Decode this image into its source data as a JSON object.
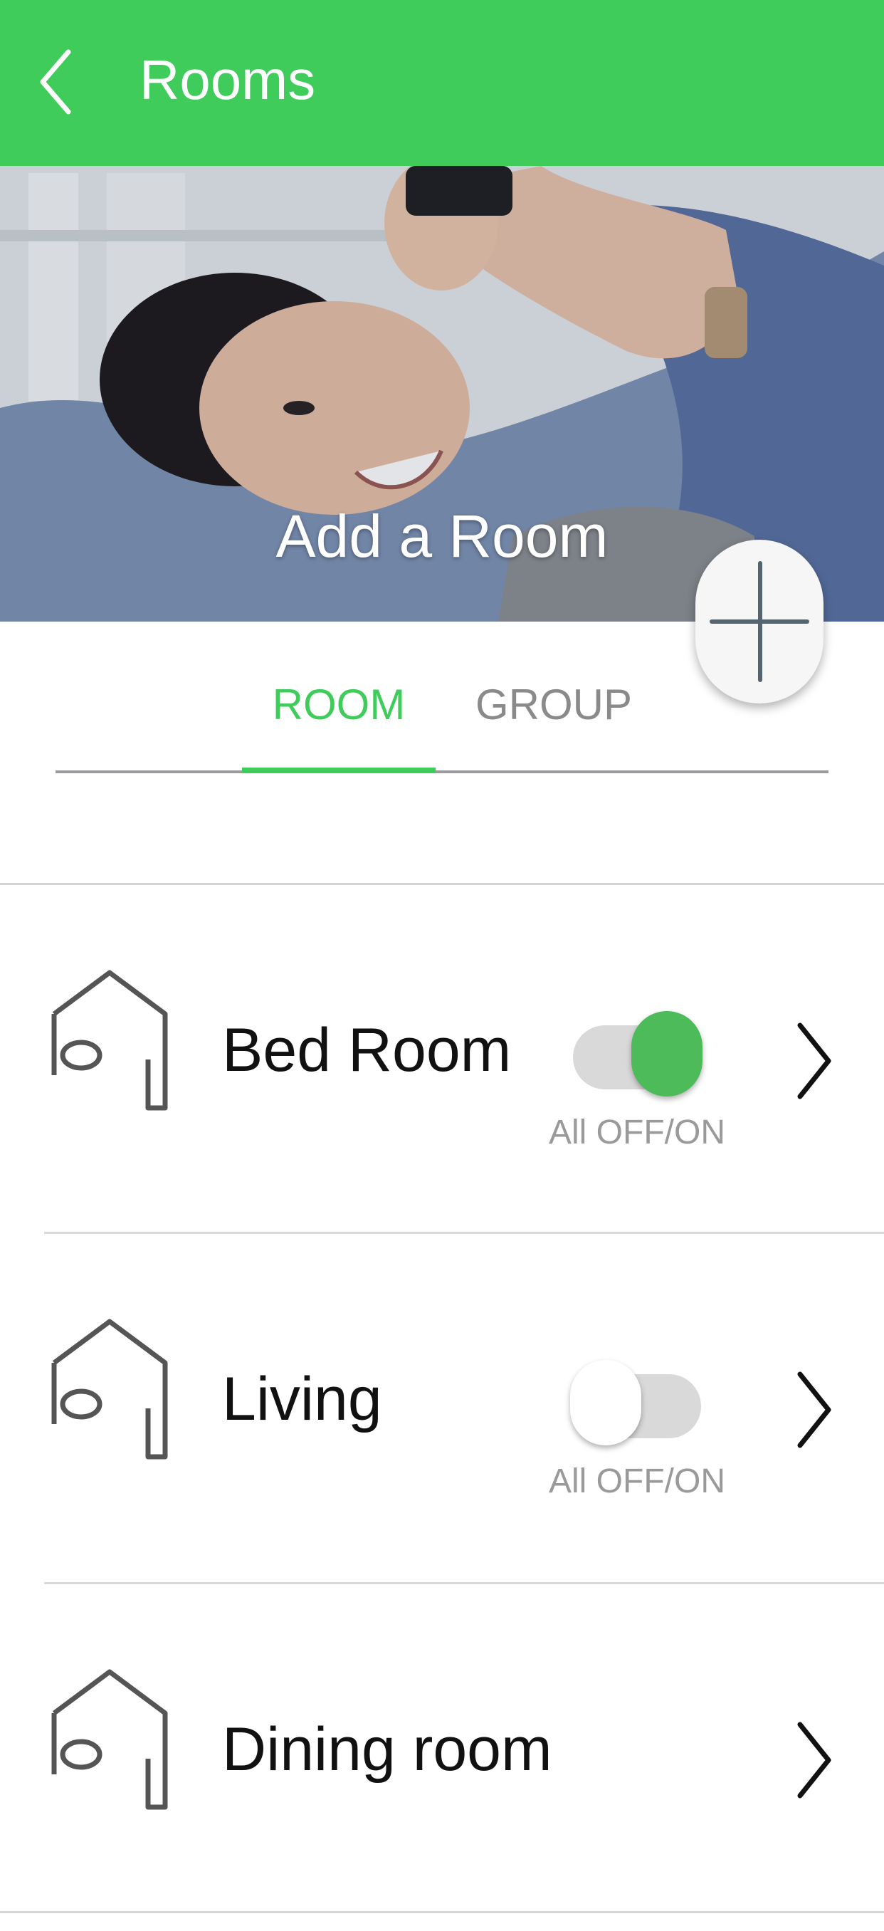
{
  "header": {
    "title": "Rooms",
    "back_icon": "chevron-left-icon",
    "background_color": "#3fcc5b"
  },
  "hero": {
    "title": "Add a Room",
    "add_icon": "plus-icon"
  },
  "tabs": [
    {
      "label": "ROOM",
      "active": true
    },
    {
      "label": "GROUP",
      "active": false
    }
  ],
  "accent_color": "#3fcc5b",
  "rooms": [
    {
      "name": "Bed Room",
      "icon": "room-icon",
      "toggle_caption": "All OFF/ON",
      "toggle_on": true,
      "chevron_icon": "chevron-right-icon"
    },
    {
      "name": "Living",
      "icon": "room-icon",
      "toggle_caption": "All OFF/ON",
      "toggle_on": false,
      "chevron_icon": "chevron-right-icon"
    },
    {
      "name": "Dining room",
      "icon": "room-icon",
      "chevron_icon": "chevron-right-icon"
    }
  ]
}
